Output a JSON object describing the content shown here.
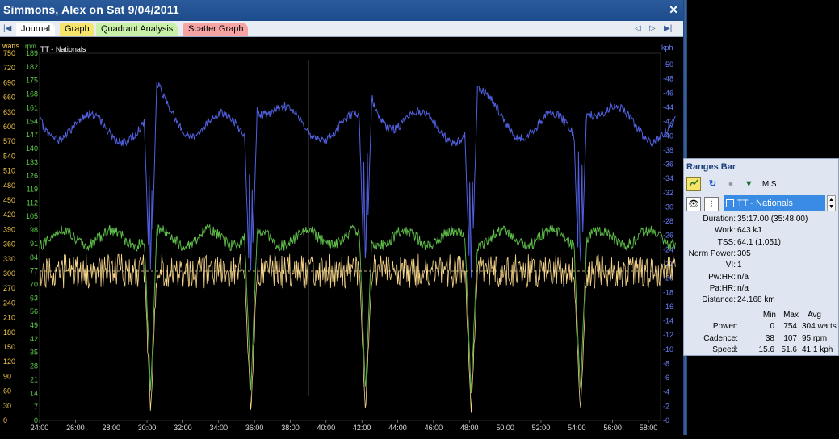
{
  "window": {
    "title": "Simmons, Alex on Sat 9/04/2011",
    "close_label": "✕"
  },
  "tabs": [
    {
      "label": "Journal",
      "color": "#ffffff"
    },
    {
      "label": "Graph",
      "color": "#f7e46a"
    },
    {
      "label": "Quadrant Analysis",
      "color": "#c9f0a8"
    },
    {
      "label": "Scatter Graph",
      "color": "#f5a3a3"
    }
  ],
  "chart_data": {
    "type": "line",
    "title": "TT - Nationals",
    "x_unit_note": "elapsed time",
    "x_ticks": [
      "24:00",
      "26:00",
      "28:00",
      "30:00",
      "32:00",
      "34:00",
      "36:00",
      "38:00",
      "40:00",
      "42:00",
      "44:00",
      "46:00",
      "48:00",
      "50:00",
      "52:00",
      "54:00",
      "56:00",
      "58:00"
    ],
    "axes": {
      "watts": {
        "label": "watts",
        "ticks": [
          750,
          720,
          690,
          660,
          630,
          600,
          570,
          540,
          510,
          480,
          450,
          420,
          390,
          360,
          330,
          300,
          270,
          240,
          210,
          180,
          150,
          120,
          90,
          60,
          30,
          0
        ],
        "range": [
          0,
          750
        ],
        "color": "#f2c84b"
      },
      "rpm": {
        "label": "rpm",
        "ticks": [
          189,
          182,
          175,
          168,
          161,
          154,
          147,
          140,
          133,
          126,
          119,
          112,
          105,
          98,
          91,
          84,
          77,
          70,
          63,
          56,
          49,
          42,
          35,
          28,
          21,
          14,
          7,
          0
        ],
        "range": [
          0,
          189
        ],
        "color": "#5fcf4b"
      },
      "kph": {
        "label": "kph",
        "ticks": [
          50,
          48,
          46,
          44,
          42,
          40,
          38,
          36,
          34,
          32,
          30,
          28,
          26,
          24,
          22,
          20,
          18,
          16,
          14,
          12,
          10,
          8,
          6,
          4,
          2,
          0
        ],
        "range": [
          0,
          51.6
        ],
        "color": "#6b7fff"
      }
    },
    "series": [
      {
        "name": "Power",
        "axis": "watts",
        "color": "#f7d58a"
      },
      {
        "name": "Cadence",
        "axis": "rpm",
        "color": "#5fbf4a"
      },
      {
        "name": "Speed",
        "axis": "kph",
        "color": "#5160e0"
      }
    ],
    "reference_lines": [
      {
        "axis": "watts",
        "value": 305,
        "style": "dashed"
      }
    ],
    "marker_time": "39:00",
    "legend": "none",
    "grid": false
  },
  "ranges_bar": {
    "title": "Ranges Bar",
    "mode_label": "M:S",
    "selected_range": "TT - Nationals",
    "stats": [
      {
        "label": "Duration:",
        "value": "35:17.00 (35:48.00)"
      },
      {
        "label": "Work:",
        "value": "643 kJ"
      },
      {
        "label": "TSS:",
        "value": "64.1 (1.051)"
      },
      {
        "label": "Norm Power:",
        "value": "305"
      },
      {
        "label": "VI:",
        "value": "1"
      },
      {
        "label": "Pw:HR:",
        "value": "n/a"
      },
      {
        "label": "Pa:HR:",
        "value": "n/a"
      },
      {
        "label": "Distance:",
        "value": "24.168 km"
      }
    ],
    "table": {
      "headers": [
        "Min",
        "Max",
        "Avg"
      ],
      "rows": [
        {
          "label": "Power:",
          "min": "0",
          "max": "754",
          "avg": "304 watts"
        },
        {
          "label": "Cadence:",
          "min": "38",
          "max": "107",
          "avg": "95 rpm"
        },
        {
          "label": "Speed:",
          "min": "15.6",
          "max": "51.6",
          "avg": "41.1 kph"
        }
      ]
    }
  }
}
